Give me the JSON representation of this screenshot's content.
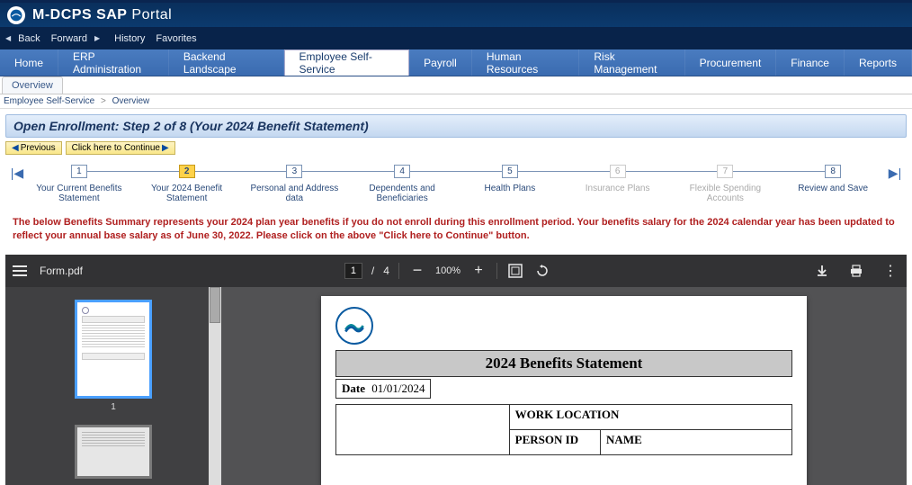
{
  "banner": {
    "title_bold": "M-DCPS",
    "title_mid": "SAP",
    "title_light": "Portal"
  },
  "history": {
    "back": "Back",
    "forward": "Forward",
    "history": "History",
    "favorites": "Favorites"
  },
  "mainnav": {
    "home": "Home",
    "erp": "ERP Administration",
    "backend": "Backend Landscape",
    "ess": "Employee Self-Service",
    "payroll": "Payroll",
    "hr": "Human Resources",
    "risk": "Risk Management",
    "procurement": "Procurement",
    "finance": "Finance",
    "reports": "Reports"
  },
  "subnav": {
    "overview": "Overview"
  },
  "breadcrumb": {
    "a": "Employee Self-Service",
    "b": "Overview"
  },
  "stepheader": "Open Enrollment: Step 2  of 8  (Your 2024 Benefit Statement)",
  "buttons": {
    "previous": "Previous",
    "continue": "Click here to Continue"
  },
  "roadmap": [
    {
      "num": "1",
      "label": "Your Current Benefits Statement",
      "state": "normal"
    },
    {
      "num": "2",
      "label": "Your 2024 Benefit Statement",
      "state": "active"
    },
    {
      "num": "3",
      "label": "Personal and Address data",
      "state": "normal"
    },
    {
      "num": "4",
      "label": "Dependents and Beneficiaries",
      "state": "normal"
    },
    {
      "num": "5",
      "label": "Health Plans",
      "state": "normal"
    },
    {
      "num": "6",
      "label": "Insurance Plans",
      "state": "disabled"
    },
    {
      "num": "7",
      "label": "Flexible Spending Accounts",
      "state": "disabled"
    },
    {
      "num": "8",
      "label": "Review and Save",
      "state": "normal"
    }
  ],
  "notice": "The below Benefits Summary represents your 2024 plan year benefits if you do not enroll during this enrollment period. Your benefits salary for the 2024 calendar year has been updated to reflect your annual base salary as of June 30, 2022. Please click on the above \"Click here to Continue\" button.",
  "pdf": {
    "filename": "Form.pdf",
    "page_current": "1",
    "page_total": "4",
    "page_sep": "/",
    "zoom": "100%",
    "thumb1": "1",
    "doc": {
      "title": "2024  Benefits Statement",
      "date_label": "Date",
      "date_value": "01/01/2024",
      "work_location": "WORK LOCATION",
      "person_id": "PERSON ID",
      "name": "NAME"
    }
  }
}
